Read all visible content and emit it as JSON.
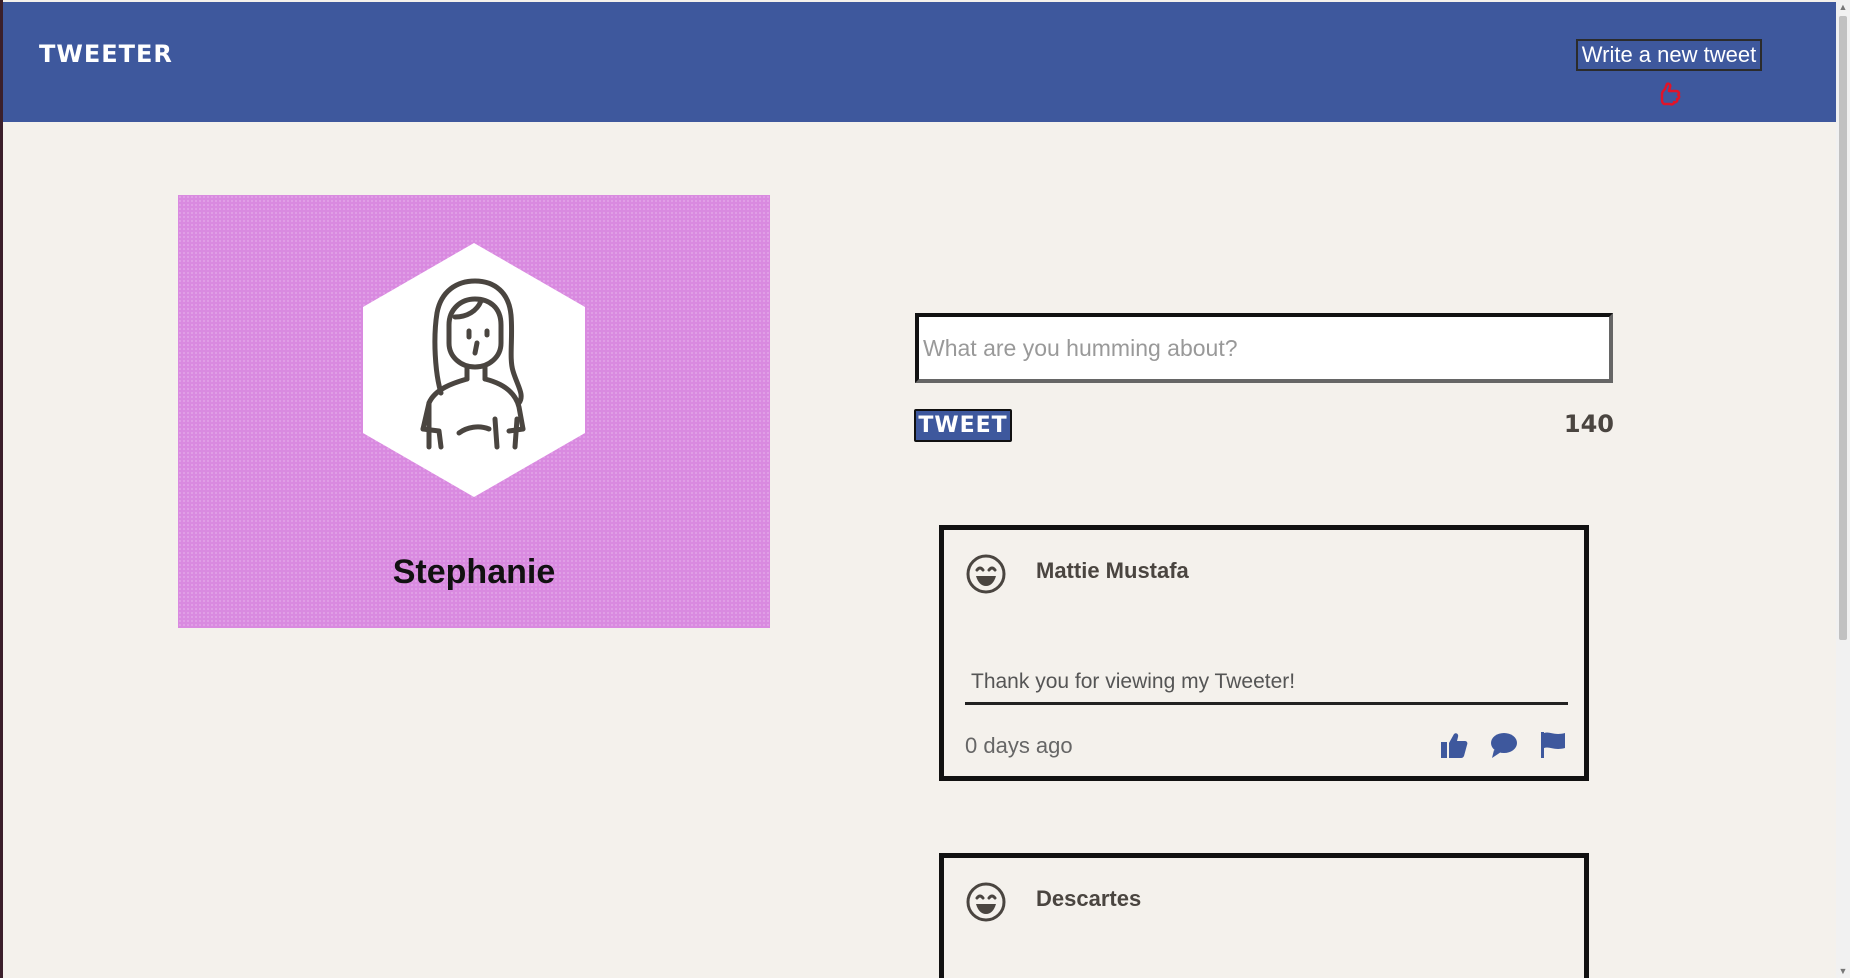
{
  "header": {
    "brand": "TWEETER",
    "compose_label": "Write a new tweet"
  },
  "profile": {
    "name": "Stephanie",
    "avatar_icon": "woman-avatar-icon",
    "card_color": "#d98ae0"
  },
  "composer": {
    "placeholder": "What are you humming about?",
    "value": "",
    "submit_label": "TWEET",
    "char_count": "140"
  },
  "tweets": [
    {
      "author": "Mattie Mustafa",
      "avatar_icon": "smiley-face-icon",
      "body": "Thank you for viewing my Tweeter!",
      "timestamp": "0 days ago",
      "actions": [
        "thumbs-up-icon",
        "comment-icon",
        "flag-icon"
      ]
    },
    {
      "author": "Descartes",
      "avatar_icon": "smiley-face-icon"
    }
  ],
  "colors": {
    "nav": "#3e589d",
    "background": "#f4f1ec",
    "accent": "#3e589d"
  }
}
